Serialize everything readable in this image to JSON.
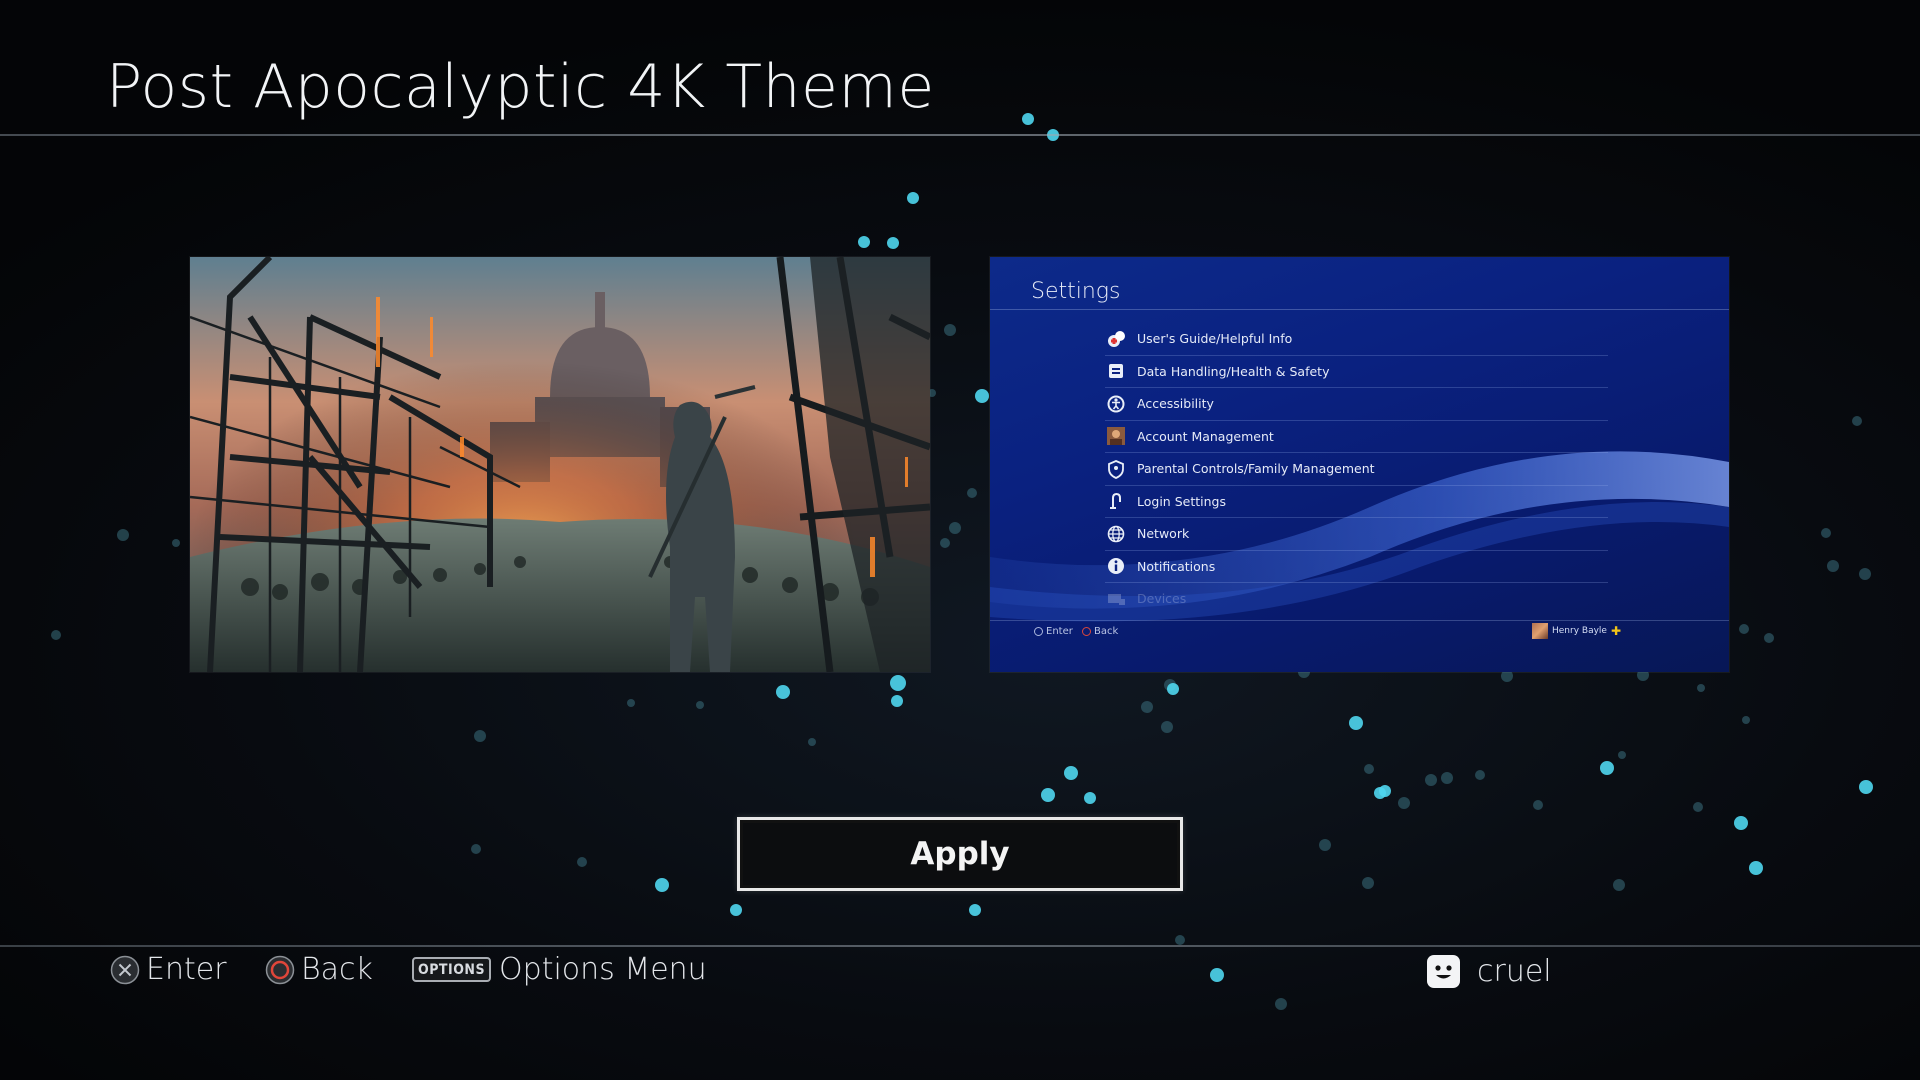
{
  "theme": {
    "title": "Post Apocalyptic 4K Theme"
  },
  "settings_preview": {
    "title": "Settings",
    "items": [
      {
        "label": "User's Guide/Helpful Info",
        "icon": "help-bubbles-icon"
      },
      {
        "label": "Data Handling/Health & Safety",
        "icon": "data-handling-icon"
      },
      {
        "label": "Accessibility",
        "icon": "accessibility-icon"
      },
      {
        "label": "Account Management",
        "icon": "account-avatar-icon"
      },
      {
        "label": "Parental Controls/Family Management",
        "icon": "parental-controls-icon"
      },
      {
        "label": "Login Settings",
        "icon": "login-icon"
      },
      {
        "label": "Network",
        "icon": "globe-icon"
      },
      {
        "label": "Notifications",
        "icon": "info-icon"
      },
      {
        "label": "Devices",
        "icon": "devices-icon"
      }
    ],
    "footer": {
      "enter_label": "Enter",
      "back_label": "Back",
      "user_name": "Henry Bayle",
      "plus_symbol": "✚"
    }
  },
  "apply_button": {
    "label": "Apply"
  },
  "footer": {
    "enter_label": "Enter",
    "back_label": "Back",
    "options_badge": "OPTIONS",
    "options_label": "Options Menu"
  },
  "user": {
    "name": "cruel"
  },
  "colors": {
    "accent_particles": "#4fd6ee",
    "settings_bg": "#0a2180",
    "back_circle": "#e0463a"
  }
}
